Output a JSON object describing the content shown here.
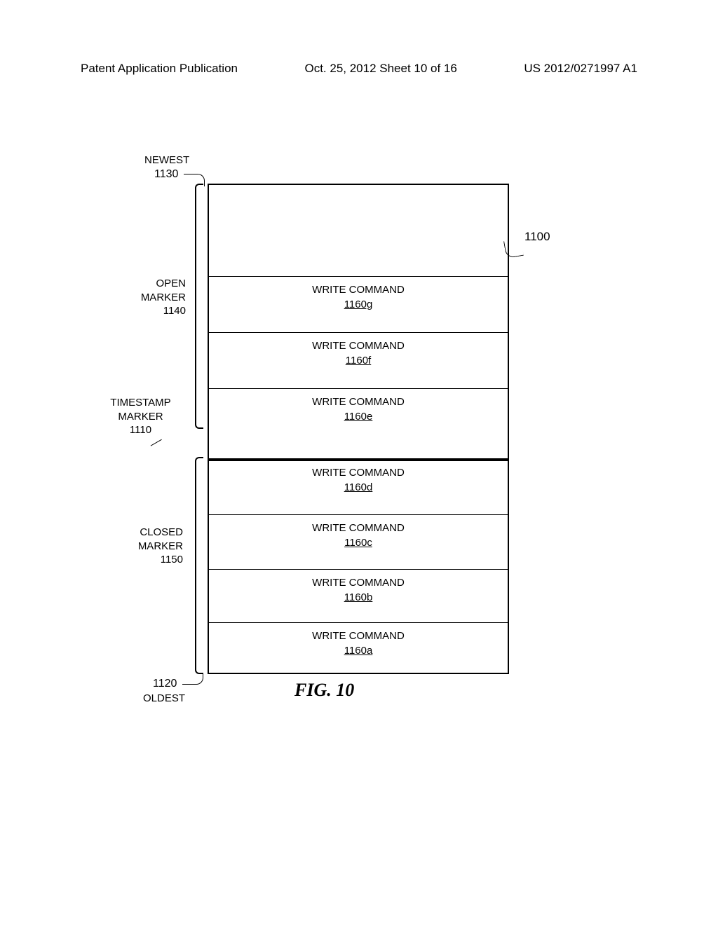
{
  "header": {
    "left": "Patent Application Publication",
    "center": "Oct. 25, 2012  Sheet 10 of 16",
    "right": "US 2012/0271997 A1"
  },
  "labels": {
    "newest": "NEWEST",
    "oldest": "OLDEST",
    "open_marker_l1": "OPEN",
    "open_marker_l2": "MARKER",
    "open_marker_ref": "1140",
    "closed_marker_l1": "CLOSED",
    "closed_marker_l2": "MARKER",
    "closed_marker_ref": "1150",
    "timestamp_l1": "TIMESTAMP",
    "timestamp_l2": "MARKER",
    "timestamp_ref": "1110",
    "ref_1130": "1130",
    "ref_1120": "1120",
    "ref_1100": "1100"
  },
  "rows": {
    "g": {
      "label": "WRITE COMMAND",
      "ref": "1160g"
    },
    "f": {
      "label": "WRITE COMMAND",
      "ref": "1160f"
    },
    "e": {
      "label": "WRITE COMMAND",
      "ref": "1160e"
    },
    "d": {
      "label": "WRITE COMMAND",
      "ref": "1160d"
    },
    "c": {
      "label": "WRITE COMMAND",
      "ref": "1160c"
    },
    "b": {
      "label": "WRITE COMMAND",
      "ref": "1160b"
    },
    "a": {
      "label": "WRITE COMMAND",
      "ref": "1160a"
    }
  },
  "figure_caption": "FIG. 10"
}
